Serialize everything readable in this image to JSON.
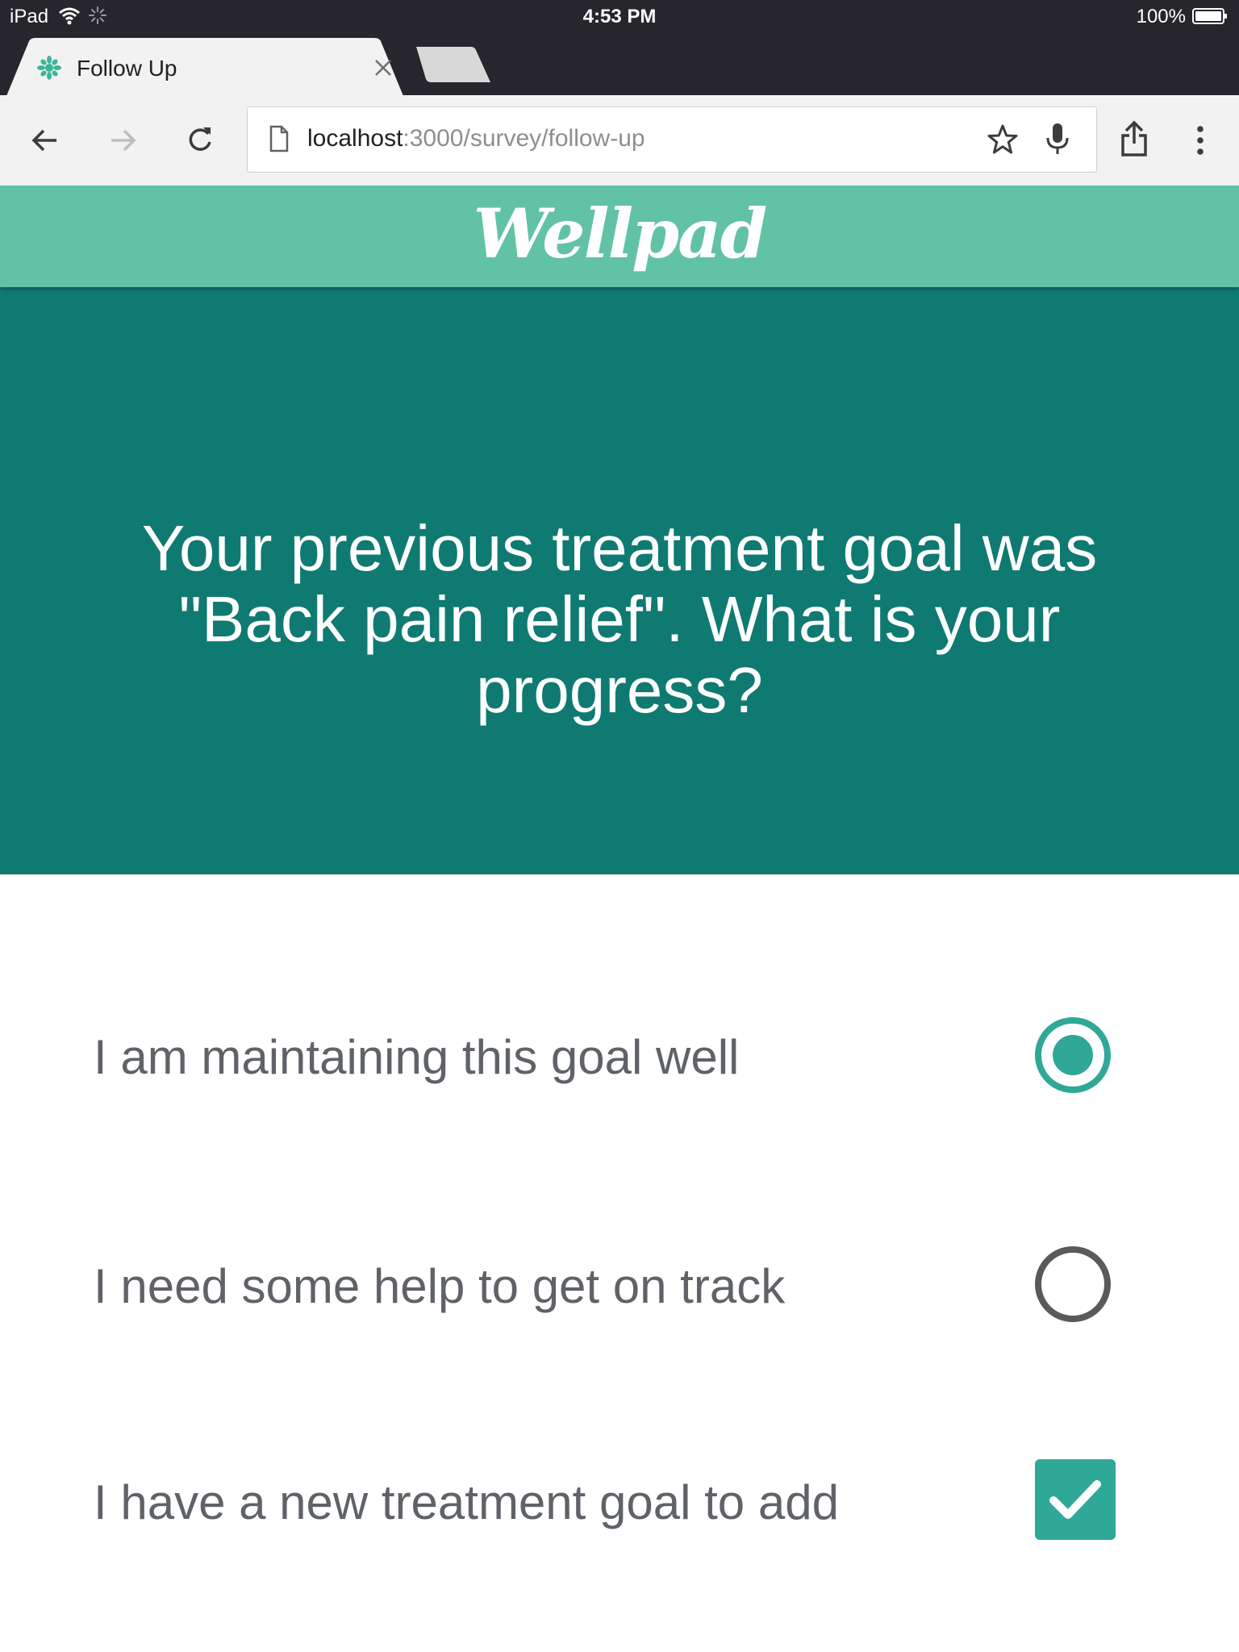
{
  "status_bar": {
    "device": "iPad",
    "time": "4:53 PM",
    "battery_percent": "100%"
  },
  "browser": {
    "tab": {
      "title": "Follow Up"
    },
    "address_bar": {
      "host": "localhost",
      "path": ":3000/survey/follow-up"
    }
  },
  "app": {
    "logo_text": "Wellpad",
    "header_color": "#62c2a6",
    "hero_color": "#0f7a71",
    "accent_color": "#2fa898"
  },
  "survey": {
    "question_lines": [
      "Your previous treatment goal was",
      "\"Back pain relief\". What is your",
      "progress?"
    ],
    "options": [
      {
        "label": "I am maintaining this goal well",
        "control": "radio",
        "selected": true
      },
      {
        "label": "I need some help to get on track",
        "control": "radio",
        "selected": false
      },
      {
        "label": "I have a new treatment goal to add",
        "control": "checkbox",
        "checked": true
      }
    ]
  }
}
